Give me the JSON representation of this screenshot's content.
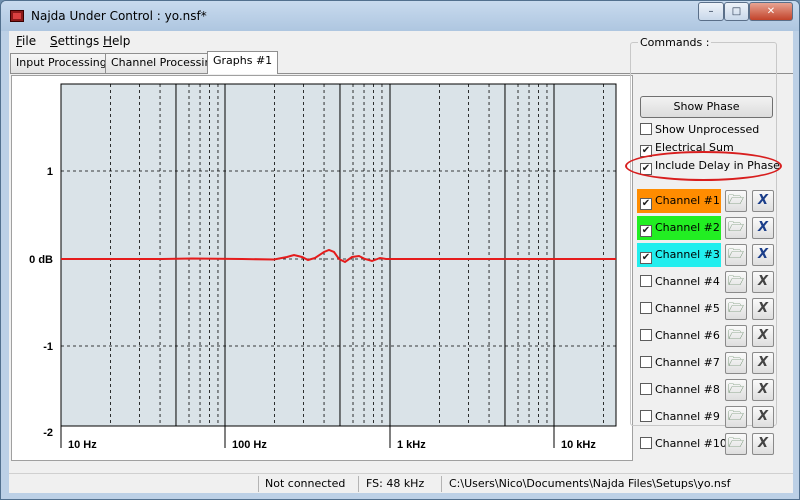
{
  "window": {
    "title": "Najda Under Control : yo.nsf*",
    "controls": {
      "minimize": "–",
      "maximize": "□",
      "close": "✕"
    }
  },
  "menu": [
    {
      "accel": "F",
      "rest": "ile"
    },
    {
      "accel": "S",
      "rest": "ettings"
    },
    {
      "accel": "H",
      "rest": "elp"
    }
  ],
  "tabs": [
    "Input Processing",
    "Channel Processing",
    "Graphs #1"
  ],
  "active_tab": 2,
  "graph": {
    "y_labels": [
      "1",
      "0 dB",
      "-1",
      "-2"
    ],
    "x_labels": [
      "10 Hz",
      "100 Hz",
      "1 kHz",
      "10 kHz"
    ],
    "line_color": "#e51c1c",
    "plot_bg": "#dae3e8"
  },
  "commands": {
    "title": "Commands :",
    "show_phase": "Show Phase",
    "options": [
      {
        "label": "Show Unprocessed",
        "checked": false
      },
      {
        "label": "Electrical Sum",
        "checked": true
      },
      {
        "label": "Include Delay in Phase",
        "checked": true
      }
    ],
    "highlight_color": "#d81e1e"
  },
  "channels": [
    {
      "label": "Channel #1",
      "checked": true,
      "color": "#ff8c00"
    },
    {
      "label": "Channel #2",
      "checked": true,
      "color": "#22ee22"
    },
    {
      "label": "Channel #3",
      "checked": true,
      "color": "#22eeee"
    },
    {
      "label": "Channel #4",
      "checked": false,
      "color": ""
    },
    {
      "label": "Channel #5",
      "checked": false,
      "color": ""
    },
    {
      "label": "Channel #6",
      "checked": false,
      "color": ""
    },
    {
      "label": "Channel #7",
      "checked": false,
      "color": ""
    },
    {
      "label": "Channel #8",
      "checked": false,
      "color": ""
    },
    {
      "label": "Channel #9",
      "checked": false,
      "color": ""
    },
    {
      "label": "Channel #10",
      "checked": false,
      "color": ""
    }
  ],
  "icons": {
    "load": "folder-load-icon",
    "clear": "clear-x-icon"
  },
  "status": {
    "connection": "Not connected",
    "sample_rate": "FS: 48 kHz",
    "path": "C:\\Users\\Nico\\Documents\\Najda Files\\Setups\\yo.nsf"
  }
}
